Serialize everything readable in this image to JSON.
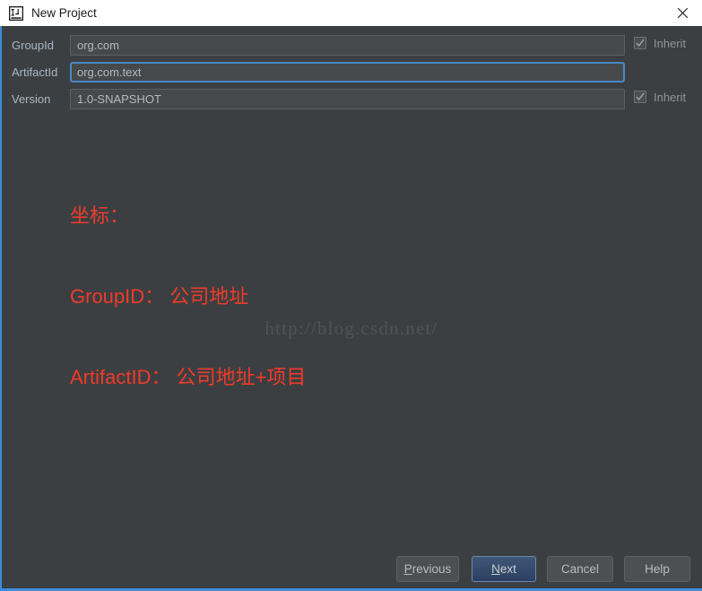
{
  "window": {
    "title": "New Project",
    "app_icon": "intellij-idea-icon",
    "close_icon": "close-icon",
    "accent_color": "#3a8ddb",
    "background_color": "#3c3f41"
  },
  "form": {
    "rows": [
      {
        "label": "GroupId",
        "value": "org.com",
        "placeholder": "GroupId",
        "focused": false,
        "inherit": {
          "label": "Inherit",
          "checked": true,
          "visible": true
        }
      },
      {
        "label": "ArtifactId",
        "value": "org.com.text",
        "placeholder": "ArtifactId",
        "focused": true,
        "inherit": {
          "label": "",
          "checked": false,
          "visible": false
        }
      },
      {
        "label": "Version",
        "value": "1.0-SNAPSHOT",
        "placeholder": "Version",
        "focused": false,
        "inherit": {
          "label": "Inherit",
          "checked": true,
          "visible": true
        }
      }
    ]
  },
  "annotation": {
    "color": "#ee3b2b",
    "lines": [
      "坐标：",
      "GroupID： 公司地址",
      "ArtifactID： 公司地址+项目"
    ]
  },
  "watermark": {
    "text": "http://blog.csdn.net/",
    "color": "#4e5356"
  },
  "buttons": {
    "previous": {
      "label": "Previous",
      "mnemonic": "P",
      "default": false
    },
    "next": {
      "label": "Next",
      "mnemonic": "N",
      "default": true
    },
    "cancel": {
      "label": "Cancel",
      "mnemonic": "",
      "default": false
    },
    "help": {
      "label": "Help",
      "mnemonic": "",
      "default": false
    }
  }
}
